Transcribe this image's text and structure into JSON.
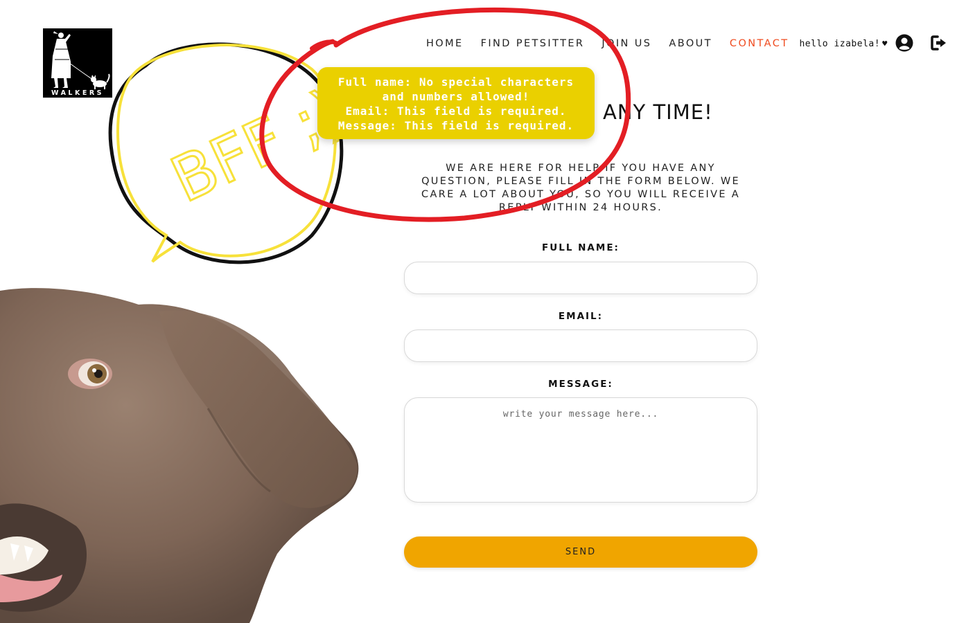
{
  "brand": {
    "logo_text": "WALKERS"
  },
  "nav": {
    "items": [
      {
        "label": "HOME"
      },
      {
        "label": "FIND PETSITTER"
      },
      {
        "label": "JOIN US"
      },
      {
        "label": "ABOUT"
      },
      {
        "label": "CONTACT",
        "active": true
      }
    ],
    "greeting": "hello izabela!",
    "heart": "♥",
    "user_icon": "user-circle-icon",
    "logout_icon": "sign-out-icon"
  },
  "decoration": {
    "bubble_text": "BFF ;)"
  },
  "tooltip": {
    "lines": [
      "Full name: No special characters",
      "and numbers allowed!",
      "Email: This field is required.",
      "Message: This field is required."
    ],
    "color": "#ead000"
  },
  "main": {
    "heading": "ANY TIME!",
    "intro": "WE ARE HERE FOR HELP IF YOU HAVE ANY QUESTION, PLEASE FILL IN THE FORM BELOW. WE CARE A LOT ABOUT YOU, SO YOU WILL RECEIVE A REPLY WITHIN 24 HOURS."
  },
  "form": {
    "fullname_label": "FULL NAME:",
    "fullname_value": "",
    "email_label": "EMAIL:",
    "email_value": "",
    "message_label": "MESSAGE:",
    "message_placeholder": "write your message here...",
    "send_label": "SEND",
    "send_color": "#f0a500"
  },
  "colors": {
    "accent": "#ef4b1f",
    "annotation": "#e31e24"
  }
}
